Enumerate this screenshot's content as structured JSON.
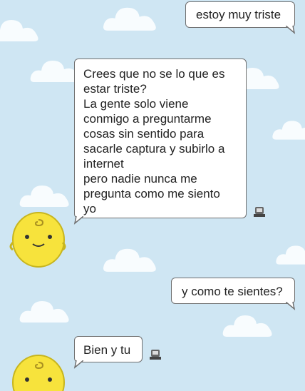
{
  "messages": [
    {
      "from": "user",
      "text": "estoy muy triste"
    },
    {
      "from": "bot",
      "text": "Crees que no se lo que es\nestar triste?\nLa gente solo viene\nconmigo a preguntarme\ncosas sin sentido para\nsacarle captura y subirlo a\ninternet\npero nadie nunca me\npregunta como me siento\nyo"
    },
    {
      "from": "user",
      "text": "y como te sientes?"
    },
    {
      "from": "bot",
      "text": "Bien y tu"
    }
  ],
  "colors": {
    "background": "#cfe6f3",
    "cloud": "#ffffff",
    "avatar": "#f7e33c",
    "bubble_border": "#6f6f6f"
  },
  "icons": [
    "cloud-icon",
    "report-flag-icon",
    "simsimi-avatar-icon"
  ]
}
